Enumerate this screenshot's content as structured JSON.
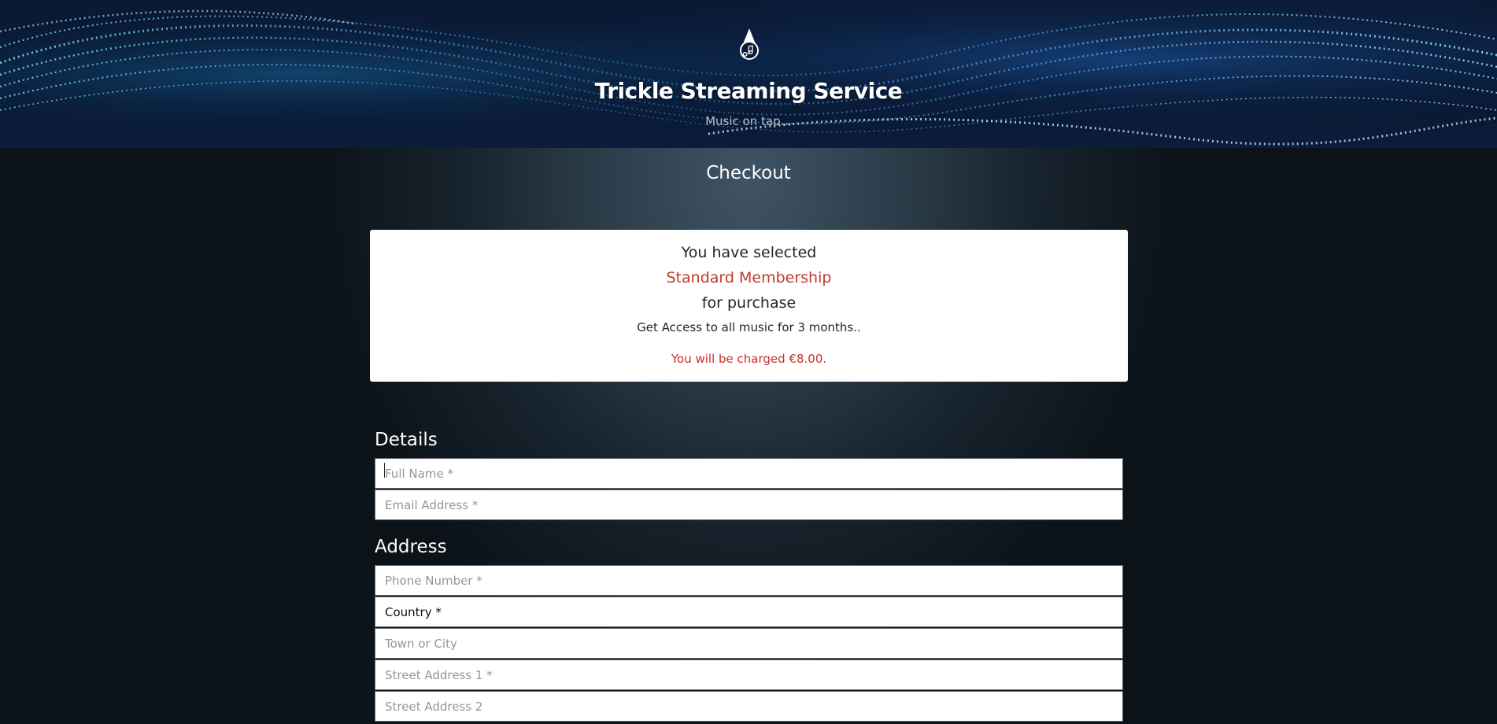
{
  "header": {
    "title": "Trickle Streaming Service",
    "tagline": "Music on tap...",
    "logo_icon": "water-drop-music-note-icon"
  },
  "page": {
    "heading": "Checkout"
  },
  "summary": {
    "selected_text": "You have selected",
    "product": "Standard Membership",
    "for_purchase": "for purchase",
    "description": "Get Access to all music for 3 months..",
    "charge": "You will be charged €8.00."
  },
  "details": {
    "label": "Details",
    "full_name_placeholder": "Full Name *",
    "email_placeholder": "Email Address *"
  },
  "address": {
    "label": "Address",
    "phone_placeholder": "Phone Number *",
    "country_selected": "Country *",
    "town_placeholder": "Town or City",
    "street1_placeholder": "Street Address 1 *",
    "street2_placeholder": "Street Address 2"
  },
  "colors": {
    "accent_red": "#c0392b",
    "panel_white": "#ffffff",
    "background_dark": "#0b1218"
  }
}
